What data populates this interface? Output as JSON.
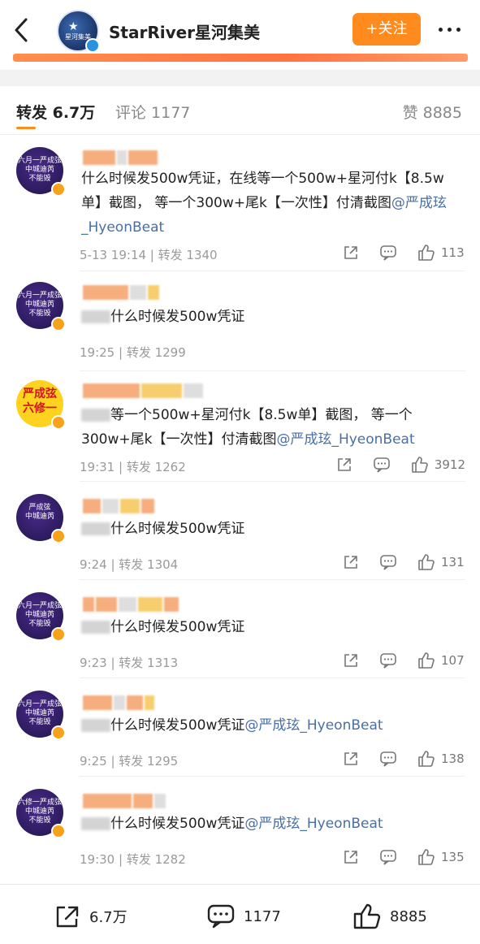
{
  "header": {
    "account_name": "StarRiver星河集美",
    "avatar_text": "星河集美",
    "follow_label": "+关注"
  },
  "tabs": {
    "repost": "转发 6.7万",
    "comment": "评论 1177",
    "like": "赞 8885"
  },
  "reposts": [
    {
      "avatar_text": "六月一严成弦\n中城迪芮\n不能毁",
      "text": "什么时候发500w凭证，在线等一个500w+星河付k【8.5w单】截图， 等一个300w+尾k【一次性】付清截图",
      "mention": "@严成玹_HyeonBeat",
      "meta": "5-13 19:14 | 转发 1340",
      "likes": "113"
    },
    {
      "avatar_text": "六月一严成弦\n中城迪芮\n不能毁",
      "text": "什么时候发500w凭证",
      "mention": "",
      "meta": "19:25 | 转发 1299",
      "likes": ""
    },
    {
      "avatar_text": "严成弦\n六修一",
      "text": "等一个500w+星河付k【8.5w单】截图， 等一个300w+尾k【一次性】付清截图",
      "mention": "@严成玹_HyeonBeat",
      "meta": "19:31 | 转发 1262",
      "likes": "3912"
    },
    {
      "avatar_text": "严成弦\n中城迪芮",
      "text": "什么时候发500w凭证",
      "mention": "",
      "meta": "9:24 | 转发 1304",
      "likes": "131"
    },
    {
      "avatar_text": "六月一严成弦\n中城迪芮\n不能毁",
      "text": "什么时候发500w凭证",
      "mention": "",
      "meta": "9:23 | 转发 1313",
      "likes": "107"
    },
    {
      "avatar_text": "六月一严成弦\n中城迪芮\n不能毁",
      "text": "什么时候发500w凭证",
      "mention": "@严成玹_HyeonBeat",
      "meta": "9:25 | 转发 1295",
      "likes": "138"
    },
    {
      "avatar_text": "六修一严成弦\n中城迪芮\n不能毁",
      "text": "什么时候发500w凭证",
      "mention": "@严成玹_HyeonBeat",
      "meta": "19:30 | 转发 1282",
      "likes": "135"
    }
  ],
  "footer": {
    "repost_count": "6.7万",
    "comment_count": "1177",
    "like_count": "8885"
  },
  "colors": {
    "accent": "#ff8a1d",
    "mention": "#4a6fa5",
    "meta_gray": "#9a9a9a"
  }
}
